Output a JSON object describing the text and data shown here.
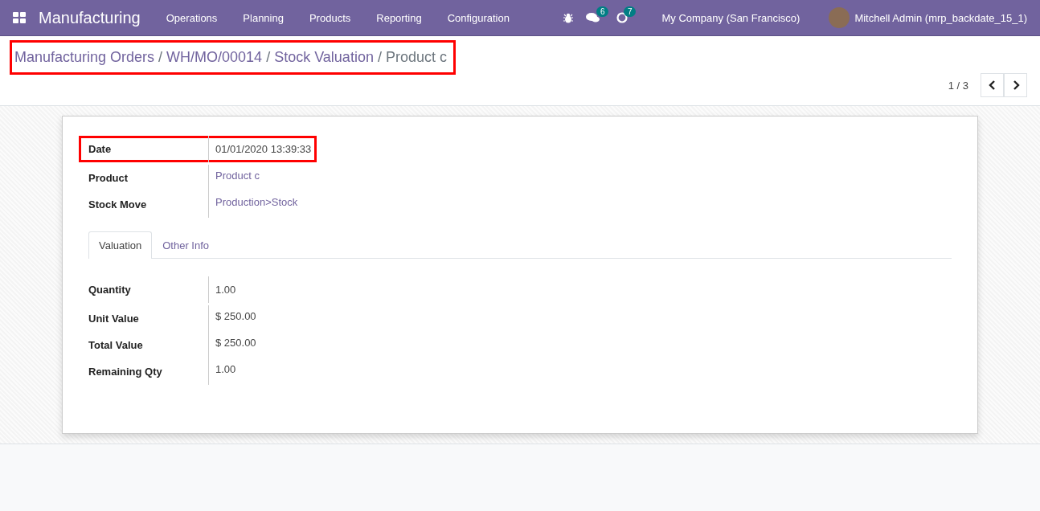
{
  "navbar": {
    "app_name": "Manufacturing",
    "menu": [
      "Operations",
      "Planning",
      "Products",
      "Reporting",
      "Configuration"
    ],
    "messages_badge": "6",
    "activities_badge": "7",
    "company": "My Company (San Francisco)",
    "user": "Mitchell Admin (mrp_backdate_15_1)"
  },
  "breadcrumb": {
    "highlighted": true,
    "separator": "/",
    "items": [
      {
        "label": "Manufacturing Orders",
        "link": true
      },
      {
        "label": "WH/MO/00014",
        "link": true
      },
      {
        "label": "Stock Valuation",
        "link": true
      },
      {
        "label": "Product c",
        "link": false
      }
    ]
  },
  "pager": {
    "value": "1 / 3"
  },
  "fields": [
    {
      "label": "Date",
      "value": "01/01/2020 13:39:33",
      "link": false,
      "highlighted": true
    },
    {
      "label": "Product",
      "value": "Product c",
      "link": true,
      "highlighted": false
    },
    {
      "label": "Stock Move",
      "value": "Production>Stock",
      "link": true,
      "highlighted": false
    }
  ],
  "tabs": [
    {
      "label": "Valuation",
      "selected": true
    },
    {
      "label": "Other Info",
      "selected": false
    }
  ],
  "valuation": [
    {
      "label": "Quantity",
      "value": "1.00"
    },
    {
      "label": "Unit Value",
      "value": "$ 250.00"
    },
    {
      "label": "Total Value",
      "value": "$ 250.00"
    },
    {
      "label": "Remaining Qty",
      "value": "1.00"
    }
  ]
}
